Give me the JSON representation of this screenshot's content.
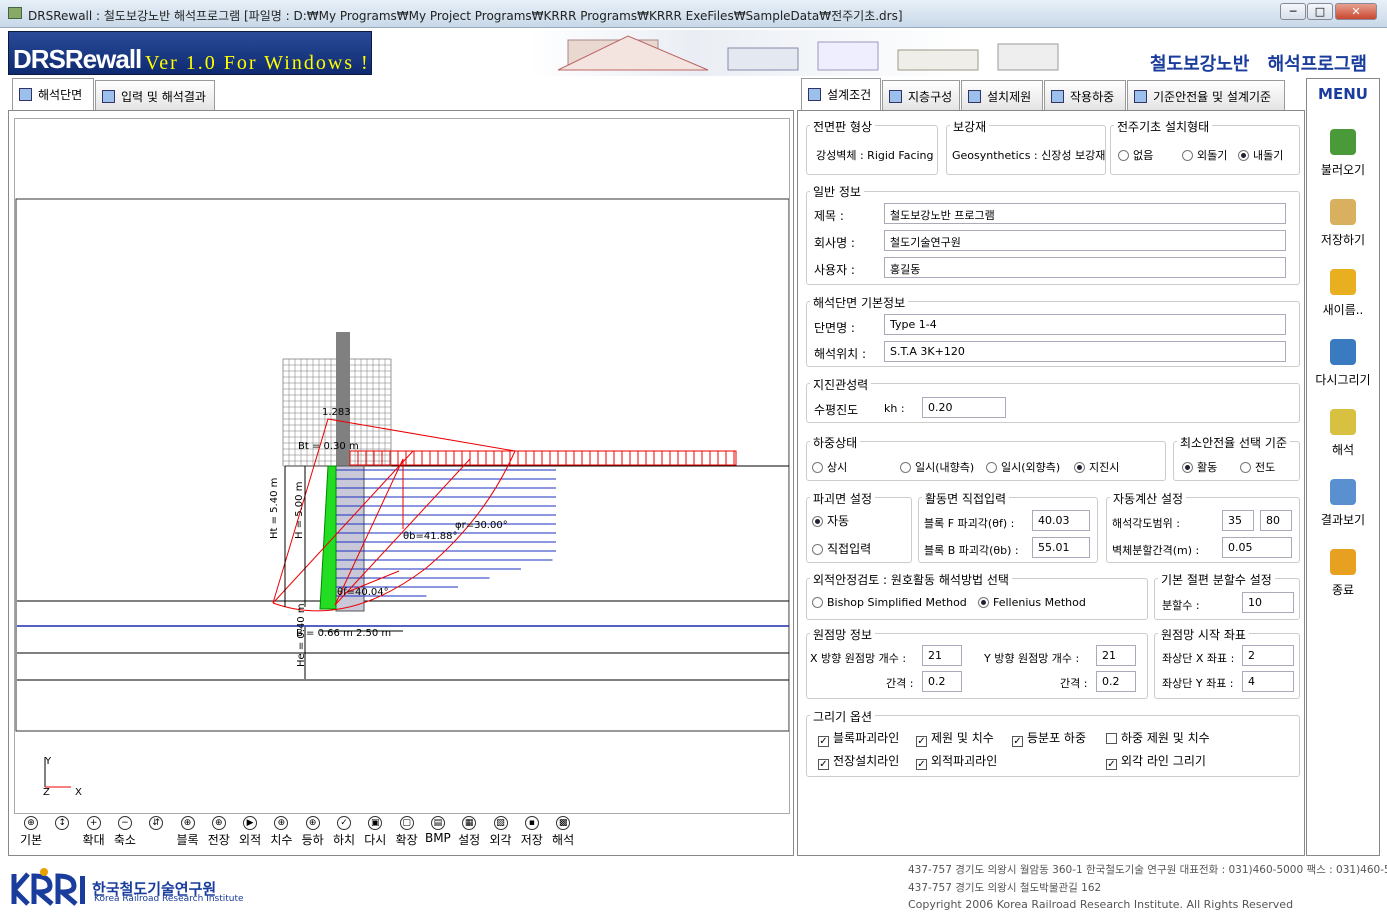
{
  "window": {
    "title": "DRSRewall : 철도보강노반 해석프로그램 [파일명 : D:₩My Programs₩My Project Programs₩KRRR Programs₩KRRR ExeFiles₩SampleData₩전주기초.drs]",
    "min": "─",
    "max": "□",
    "close": "✕"
  },
  "banner": {
    "logo_main": "DRSRewall",
    "logo_sub": "Ver 1.0 For Windows !",
    "title": "철도보강노반 해석프로그램"
  },
  "left_tabs": [
    "해석단면",
    "입력 및 해석결과"
  ],
  "right_tabs": [
    "설계조건",
    "지층구성",
    "설치제원",
    "작용하중",
    "기준안전율 및 설계기준"
  ],
  "menu": {
    "title": "MENU",
    "items": [
      "불러오기",
      "저장하기",
      "새이름..",
      "다시그리기",
      "해석",
      "결과보기",
      "종료"
    ]
  },
  "facing": {
    "label": "전면판 형상",
    "value": "강성벽체 : Rigid Facing"
  },
  "reinforce": {
    "label": "보강재",
    "value": "Geosynthetics : 신장성 보강재"
  },
  "pole": {
    "label": "전주기초 설치형태",
    "options": [
      "없음",
      "외돌기",
      "내돌기"
    ],
    "selected": 2
  },
  "general": {
    "label": "일반 정보",
    "title_label": "제목 :",
    "title": "철도보강노반 프로그램",
    "company_label": "회사명 :",
    "company": "철도기술연구원",
    "user_label": "사용자 :",
    "user": "홍길동"
  },
  "section": {
    "label": "해석단면 기본정보",
    "name_label": "단면명 :",
    "name": "Type 1-4",
    "pos_label": "해석위치 :",
    "pos": "S.T.A 3K+120"
  },
  "seismic": {
    "label": "지진관성력",
    "h_label": "수평진도",
    "kh_label": "kh :",
    "kh": "0.20"
  },
  "load": {
    "label": "하중상태",
    "options": [
      "상시",
      "일시(내향측)",
      "일시(외향측)",
      "지진시"
    ],
    "selected": 3
  },
  "minsafety": {
    "label": "최소안전율 선택 기준",
    "options": [
      "활동",
      "전도"
    ],
    "selected": 0
  },
  "failure": {
    "label": "파괴면 설정",
    "options": [
      "자동",
      "직접입력"
    ],
    "selected": 0
  },
  "slide": {
    "label": "활동면 직접입력",
    "f_label": "블록 F 파괴각(θf) :",
    "f": "40.03",
    "b_label": "블록 B 파괴각(θb) :",
    "b": "55.01"
  },
  "auto": {
    "label": "자동계산 설정",
    "range_label": "해석각도범위 :",
    "r1": "35",
    "r2": "80",
    "step_label": "벽체분할간격(m) :",
    "step": "0.05"
  },
  "external": {
    "label": "외적안정검토 : 원호활동 해석방법 선택",
    "options": [
      "Bishop Simplified Method",
      "Fellenius Method"
    ],
    "selected": 1
  },
  "slices": {
    "label": "기본 절편 분할수 설정",
    "n_label": "분할수 :",
    "n": "10"
  },
  "grid": {
    "label": "원점망 정보",
    "x_label": "X 방향 원점망 개수 :",
    "x": "21",
    "y_label": "Y 방향 원점망 개수 :",
    "y": "21",
    "dx_label": "간격 :",
    "dx": "0.2",
    "dy_label": "간격 :",
    "dy": "0.2"
  },
  "gridstart": {
    "label": "원점망 시작 좌표",
    "x_label": "좌상단 X 좌표 :",
    "x": "2",
    "y_label": "좌상단 Y 좌표 :",
    "y": "4"
  },
  "draw": {
    "label": "그리기 옵션",
    "items": [
      {
        "t": "블록파괴라인",
        "c": true
      },
      {
        "t": "제원 및 치수",
        "c": true
      },
      {
        "t": "등분포 하중",
        "c": true
      },
      {
        "t": "하중 제원 및 치수",
        "c": false
      },
      {
        "t": "전장설치라인",
        "c": true
      },
      {
        "t": "외적파괴라인",
        "c": true
      },
      {
        "t": "외각 라인 그리기",
        "c": true
      }
    ]
  },
  "toolbar": [
    "기본",
    "",
    "확대",
    "축소",
    "",
    "블록",
    "전장",
    "외적",
    "치수",
    "등하",
    "하치",
    "다시",
    "확장",
    "BMP",
    "설정",
    "외각",
    "저장",
    "해석"
  ],
  "drawing": {
    "ht": "Ht = 5.40 m",
    "h": "H = 5.00 m",
    "bt": "Bt = 0.30 m",
    "fs": "1.283",
    "tb": "θb=41.88°",
    "tr": "φr=30.00°",
    "tf": "θf=40.04°",
    "base": "B = 0.66 m  2.50 m",
    "he": "He = 0.40 m",
    "ax_y": "Y",
    "ax_z": "Z",
    "ax_x": "X"
  },
  "footer": {
    "org_ko": "한국철도기술연구원",
    "org_en": "Korea Railroad Research Institute",
    "addr1": "437-757  경기도 의왕시 월암동 360-1 한국철도기술 연구원    대표전화 : 031)460-5000    팩스 : 031)460-5159",
    "addr2": "437-757  경기도 의왕시 철도박물관길 162",
    "copy": "Copyright 2006 Korea Railroad Research Institute. All Rights Reserved"
  }
}
